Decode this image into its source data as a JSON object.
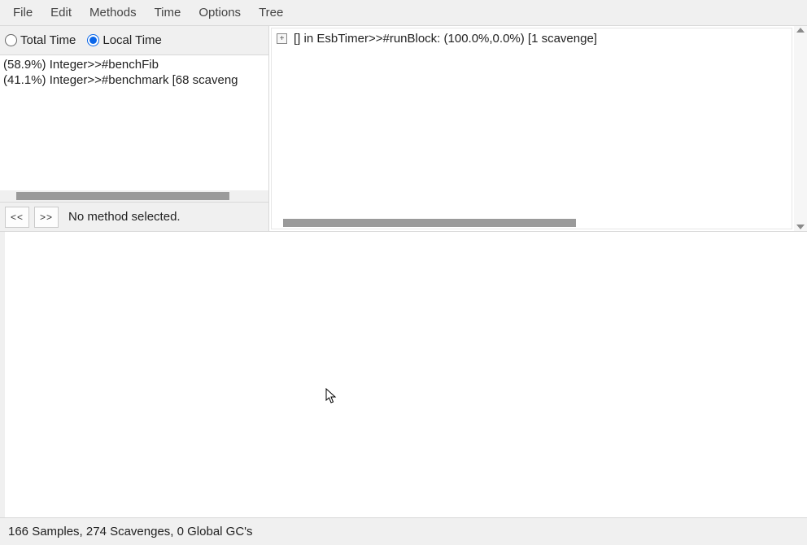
{
  "menubar": {
    "items": [
      "File",
      "Edit",
      "Methods",
      "Time",
      "Options",
      "Tree"
    ]
  },
  "timeMode": {
    "totalLabel": "Total Time",
    "localLabel": "Local Time",
    "selected": "local"
  },
  "methodList": {
    "rows": [
      "(58.9%) Integer>>#benchFib",
      "(41.1%) Integer>>#benchmark [68 scaveng"
    ]
  },
  "nav": {
    "backLabel": "<<",
    "forwardLabel": ">>",
    "status": "No method selected."
  },
  "tree": {
    "rows": [
      {
        "expandIcon": "+",
        "text": "[] in EsbTimer>>#runBlock: (100.0%,0.0%) [1 scavenge]"
      }
    ]
  },
  "footer": {
    "status": "166 Samples, 274 Scavenges, 0 Global GC's"
  }
}
